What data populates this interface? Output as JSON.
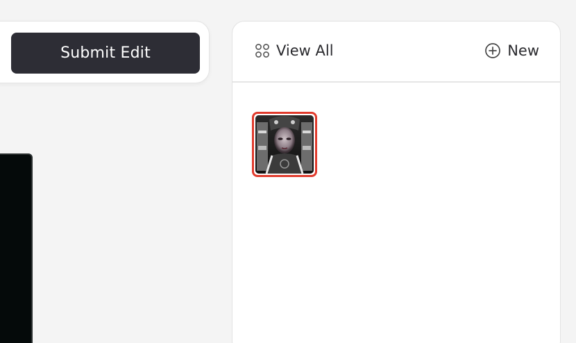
{
  "toolbar": {
    "submit_label": "Submit Edit"
  },
  "gallery": {
    "view_all_label": "View All",
    "new_label": "New",
    "view_all_icon": "grid-icon",
    "new_icon": "plus-circle-icon",
    "selected_border_color": "#e03a2c",
    "thumbnails": [
      {
        "name": "portrait-thumbnail",
        "selected": true
      }
    ]
  },
  "colors": {
    "button_bg": "#2d2d35",
    "button_text": "#ffffff",
    "page_bg": "#f4f4f4",
    "canvas_bg": "#050a0a"
  }
}
